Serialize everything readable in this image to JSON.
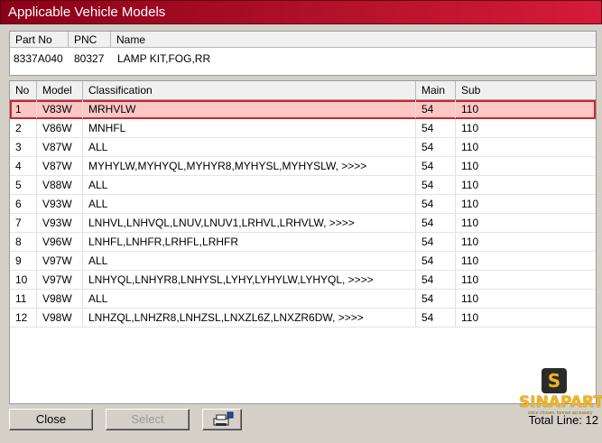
{
  "window": {
    "title": "Applicable Vehicle Models"
  },
  "part": {
    "headers": {
      "part_no": "Part No",
      "pnc": "PNC",
      "name": "Name"
    },
    "values": {
      "part_no": "8337A040",
      "pnc": "80327",
      "name": "LAMP KIT,FOG,RR"
    }
  },
  "grid": {
    "columns": {
      "no": "No",
      "model": "Model",
      "classification": "Classification",
      "main": "Main",
      "sub": "Sub"
    },
    "selected_index": 0,
    "rows": [
      {
        "no": "1",
        "model": "V83W",
        "classification": "MRHVLW",
        "main": "54",
        "sub": "110"
      },
      {
        "no": "2",
        "model": "V86W",
        "classification": "MNHFL",
        "main": "54",
        "sub": "110"
      },
      {
        "no": "3",
        "model": "V87W",
        "classification": "ALL",
        "main": "54",
        "sub": "110"
      },
      {
        "no": "4",
        "model": "V87W",
        "classification": "MYHYLW,MYHYQL,MYHYR8,MYHYSL,MYHYSLW,  >>>>",
        "main": "54",
        "sub": "110"
      },
      {
        "no": "5",
        "model": "V88W",
        "classification": "ALL",
        "main": "54",
        "sub": "110"
      },
      {
        "no": "6",
        "model": "V93W",
        "classification": "ALL",
        "main": "54",
        "sub": "110"
      },
      {
        "no": "7",
        "model": "V93W",
        "classification": "LNHVL,LNHVQL,LNUV,LNUV1,LRHVL,LRHVLW,  >>>>",
        "main": "54",
        "sub": "110"
      },
      {
        "no": "8",
        "model": "V96W",
        "classification": "LNHFL,LNHFR,LRHFL,LRHFR",
        "main": "54",
        "sub": "110"
      },
      {
        "no": "9",
        "model": "V97W",
        "classification": "ALL",
        "main": "54",
        "sub": "110"
      },
      {
        "no": "10",
        "model": "V97W",
        "classification": "LNHYQL,LNHYR8,LNHYSL,LYHY,LYHYLW,LYHYQL,  >>>>",
        "main": "54",
        "sub": "110"
      },
      {
        "no": "11",
        "model": "V98W",
        "classification": "ALL",
        "main": "54",
        "sub": "110"
      },
      {
        "no": "12",
        "model": "V98W",
        "classification": "LNHZQL,LNHZR8,LNHZSL,LNXZL6Z,LNXZR6DW,  >>>>",
        "main": "54",
        "sub": "110"
      }
    ]
  },
  "buttons": {
    "close": "Close",
    "select": "Select",
    "print_icon": "printer-icon"
  },
  "footer": {
    "total": "Total Line: 12"
  },
  "watermark": {
    "logo_letter": "S",
    "brand": "SINAPARTS",
    "tagline": "since chosen. forever accessory"
  },
  "colors": {
    "title_bar": "#b3112a",
    "selected_row": "#ffc6c6",
    "selected_border": "#c42a2a"
  }
}
